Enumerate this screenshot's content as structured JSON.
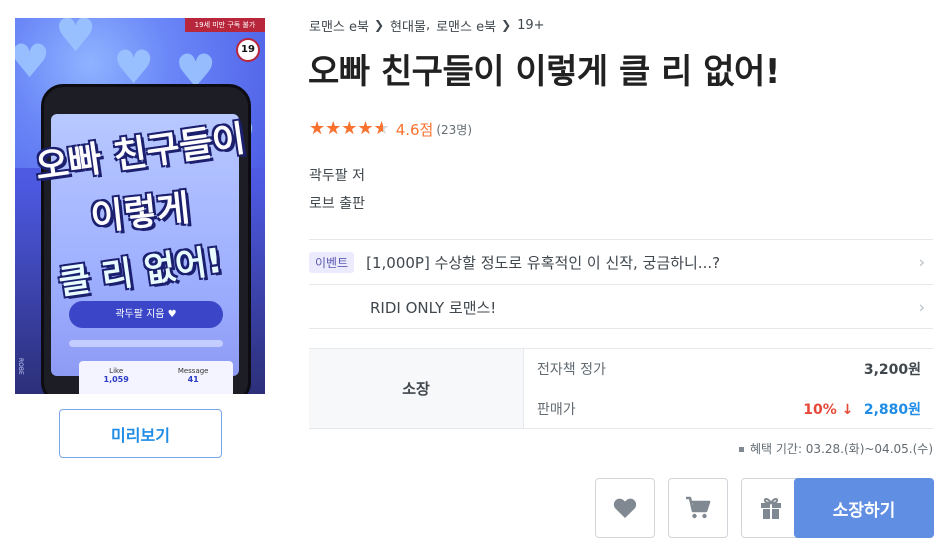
{
  "cover": {
    "age_strip": "19세 미만 구독 불가",
    "age_badge": "19",
    "title_line1": "오빠 친구들이",
    "title_line2": "이렇게",
    "title_line3": "클 리 없어!",
    "author_pill": "곽두팔 지음 ♥",
    "like_label": "Like",
    "like_count": "1,059",
    "message_label": "Message",
    "message_count": "41",
    "side_text": "ROBE"
  },
  "preview_button": "미리보기",
  "breadcrumb": {
    "items": [
      "로맨스 e북",
      "현대물",
      "로맨스 e북",
      "19+"
    ]
  },
  "book": {
    "title": "오빠 친구들이 이렇게 클 리 없어!",
    "rating_score": "4.6점",
    "rating_value": 4.6,
    "rating_max": 5,
    "rating_count": "(23명)",
    "author": "곽두팔 저",
    "publisher": "로브 출판"
  },
  "events": [
    {
      "tag": "이벤트",
      "text": "[1,000P] 수상할 정도로 유혹적인 이 신작, 궁금하니...?"
    },
    {
      "tag": "",
      "text": "RIDI ONLY 로맨스!"
    }
  ],
  "price": {
    "section_label": "소장",
    "list_label": "전자책 정가",
    "list_value": "3,200원",
    "sale_label": "판매가",
    "discount": "10%",
    "discount_arrow": "↓",
    "sale_value": "2,880원"
  },
  "benefit_period": "혜택 기간: 03.28.(화)~04.05.(수)",
  "actions": {
    "buy_label": "소장하기"
  },
  "colors": {
    "accent": "#1f8ce6",
    "star": "#fa722e",
    "discount": "#e64938",
    "buy_button": "#5f8ee3"
  }
}
